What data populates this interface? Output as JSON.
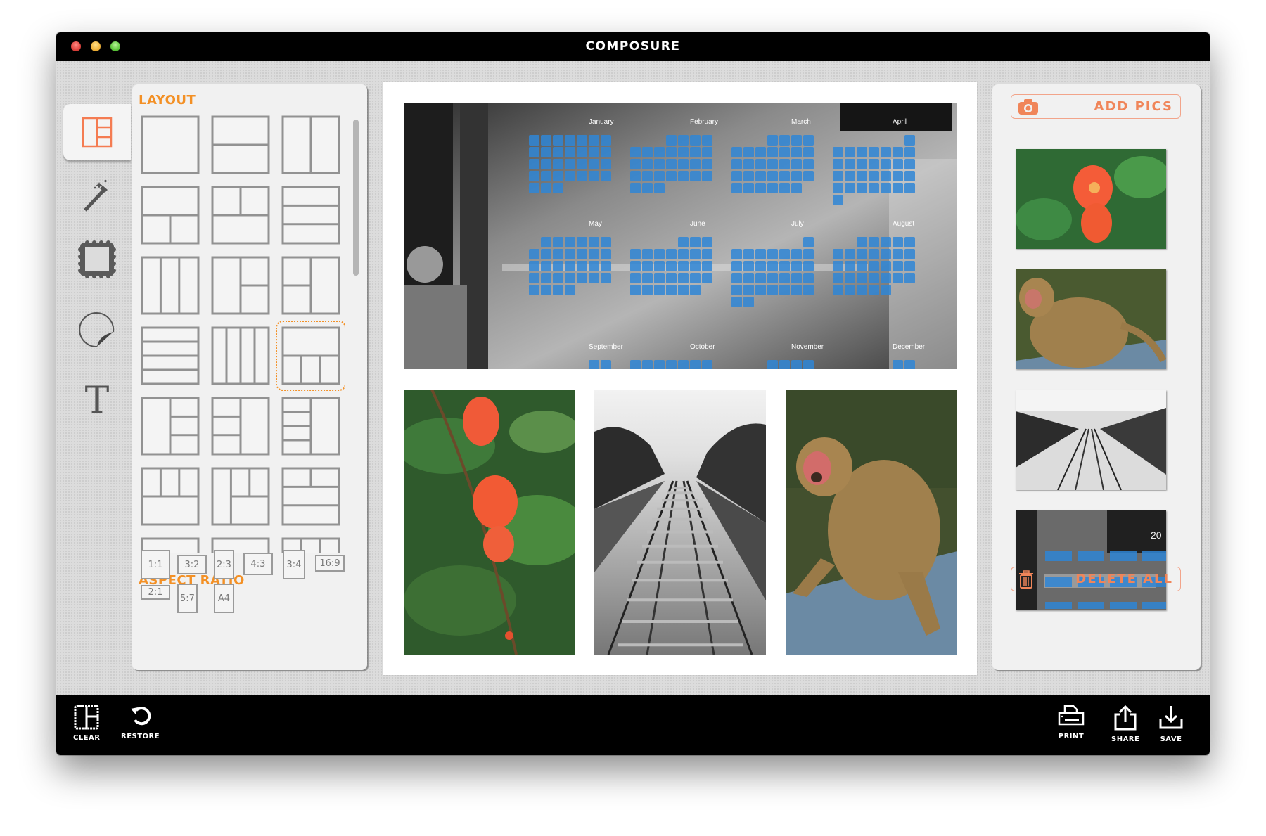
{
  "window": {
    "title": "COMPOSURE",
    "traffic_lights": [
      "close",
      "minimize",
      "zoom"
    ]
  },
  "tools": [
    {
      "id": "layout",
      "icon": "layout-icon",
      "active": true
    },
    {
      "id": "effects",
      "icon": "magic-wand-icon",
      "active": false
    },
    {
      "id": "frame",
      "icon": "frame-border-icon",
      "active": false
    },
    {
      "id": "sticker",
      "icon": "sticker-peel-icon",
      "active": false
    },
    {
      "id": "text",
      "icon": "text-icon",
      "glyph": "T",
      "active": false
    }
  ],
  "layout_panel": {
    "title": "LAYOUT",
    "selected_index": 11,
    "layouts": [
      "single",
      "two-rows",
      "two-columns",
      "top-wide-bottom-two",
      "top-two-bottom-wide",
      "three-rows",
      "three-columns",
      "left-tall-right-two",
      "left-two-right-tall",
      "four-rows",
      "four-columns",
      "top-wide-bottom-three",
      "left-tall-right-three",
      "left-three-right-tall",
      "left-three-rows-right-tall",
      "top-three-bottom-wide",
      "left-tall-right-two-over-one",
      "top-two-then-two-rows",
      "partial-a",
      "partial-b",
      "partial-c"
    ]
  },
  "aspect_ratio": {
    "title": "ASPECT RATIO",
    "options": [
      "1:1",
      "3:2",
      "2:3",
      "4:3",
      "3:4",
      "16:9",
      "2:1",
      "5:7",
      "A4"
    ]
  },
  "canvas": {
    "photos": [
      {
        "slot": "top",
        "subject": "market stall with 2018 calendar overlay",
        "months": [
          "January",
          "February",
          "March",
          "April",
          "May",
          "June",
          "July",
          "August",
          "September",
          "October",
          "November",
          "December"
        ]
      },
      {
        "slot": "bottom-left",
        "subject": "pomegranate flowers"
      },
      {
        "slot": "bottom-middle",
        "subject": "railway tracks (black and white)"
      },
      {
        "slot": "bottom-right",
        "subject": "macaque monkey"
      }
    ]
  },
  "pics_panel": {
    "add_label": "ADD PICS",
    "add_icon": "camera-icon",
    "delete_label": "DELETE ALL",
    "delete_icon": "trash-icon",
    "thumbnails": [
      {
        "subject": "pomegranate flower"
      },
      {
        "subject": "macaque monkey"
      },
      {
        "subject": "railway tracks"
      },
      {
        "subject": "market stall calendar",
        "overlay_text": "20"
      }
    ]
  },
  "bottom_bar": {
    "left": [
      {
        "label": "CLEAR",
        "icon": "clear-layout-icon"
      },
      {
        "label": "RESTORE",
        "icon": "restore-icon"
      }
    ],
    "right": [
      {
        "label": "PRINT",
        "icon": "printer-icon"
      },
      {
        "label": "SHARE",
        "icon": "share-icon"
      },
      {
        "label": "SAVE",
        "icon": "save-download-icon"
      }
    ]
  },
  "colors": {
    "accent_orange": "#f39025",
    "button_orange": "#f08559",
    "calendar_blue": "#2f86d6"
  }
}
